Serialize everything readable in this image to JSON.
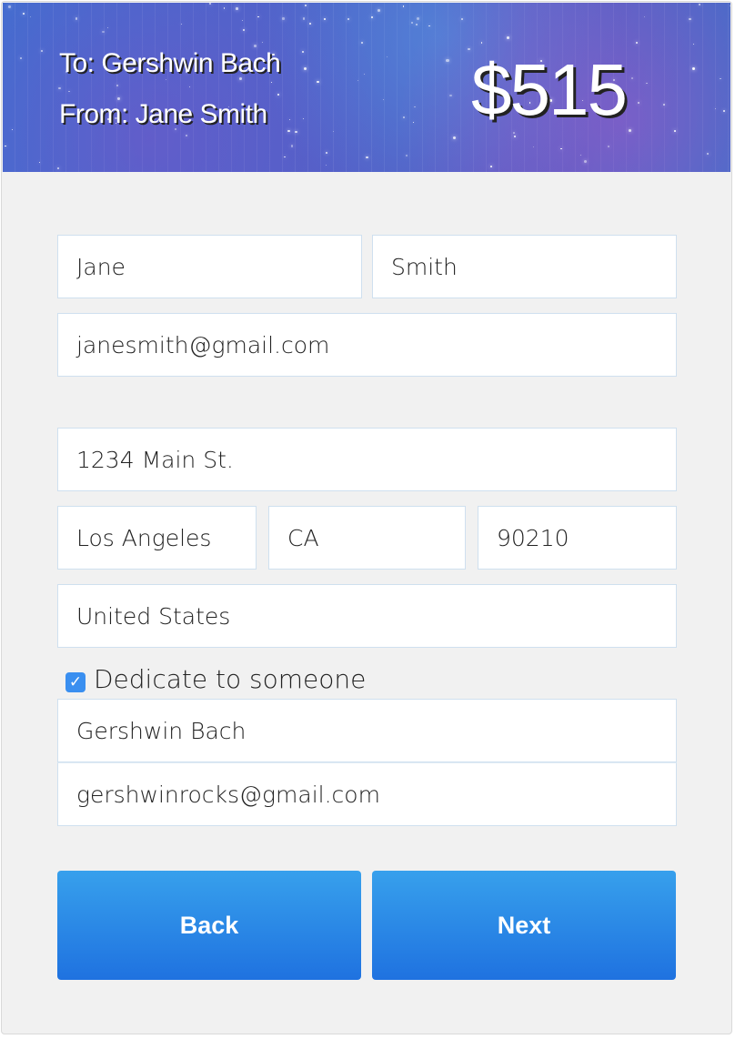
{
  "header": {
    "to": "To: Gershwin Bach",
    "from": "From: Jane Smith",
    "amount": "$515"
  },
  "form": {
    "first_name": "Jane",
    "last_name": "Smith",
    "email": "janesmith@gmail.com",
    "address": "1234 Main St.",
    "city": "Los Angeles",
    "state": "CA",
    "zip": "90210",
    "country": "United States",
    "dedicate_label": "Dedicate to someone",
    "dedicate_checked": true,
    "honoree_name": "Gershwin Bach",
    "honoree_email": "gershwinrocks@gmail.com"
  },
  "buttons": {
    "back": "Back",
    "next": "Next"
  },
  "colors": {
    "button": "#2a87e8",
    "checkbox": "#3a8ff0",
    "background": "#f1f1f1"
  }
}
